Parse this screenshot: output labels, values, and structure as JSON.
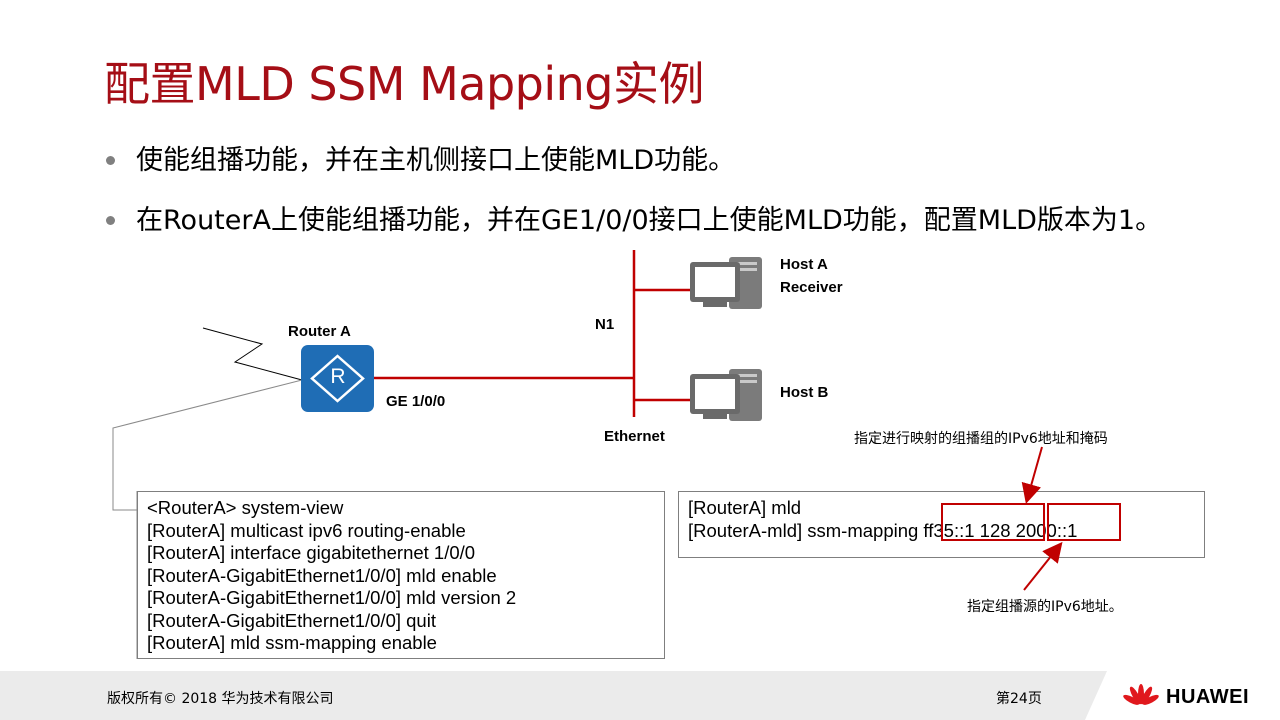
{
  "slide": {
    "title": "配置MLD SSM Mapping实例",
    "bullets": [
      "使能组播功能，并在主机侧接口上使能MLD功能。",
      "在RouterA上使能组播功能，并在GE1/0/0接口上使能MLD功能，配置MLD版本为1。"
    ]
  },
  "topology": {
    "router_label": "Router A",
    "router_icon_letter": "R",
    "interface_label": "GE 1/0/0",
    "segment_label": "N1",
    "network_label": "Ethernet",
    "host_a_label_line1": "Host A",
    "host_a_label_line2": "Receiver",
    "host_b_label": "Host B"
  },
  "config_left": {
    "lines": [
      "<RouterA> system-view",
      "[RouterA] multicast ipv6 routing-enable",
      "[RouterA] interface gigabitethernet 1/0/0",
      "[RouterA-GigabitEthernet1/0/0] mld enable",
      "[RouterA-GigabitEthernet1/0/0] mld version 2",
      "[RouterA-GigabitEthernet1/0/0] quit",
      "[RouterA] mld ssm-mapping enable"
    ]
  },
  "config_right": {
    "lines": [
      "[RouterA] mld",
      "[RouterA-mld] ssm-mapping ff35::1 128 2000::1"
    ],
    "annotation_top": "指定进行映射的组播组的IPv6地址和掩码",
    "annotation_bottom": "指定组播源的IPv6地址。"
  },
  "footer": {
    "copyright": "版权所有© 2018 华为技术有限公司",
    "page": "第24页",
    "brand": "HUAWEI"
  },
  "colors": {
    "title": "#a50e16",
    "link_red": "#c00000",
    "router_blue": "#1f6db5",
    "footer_bg": "#ebebeb"
  }
}
